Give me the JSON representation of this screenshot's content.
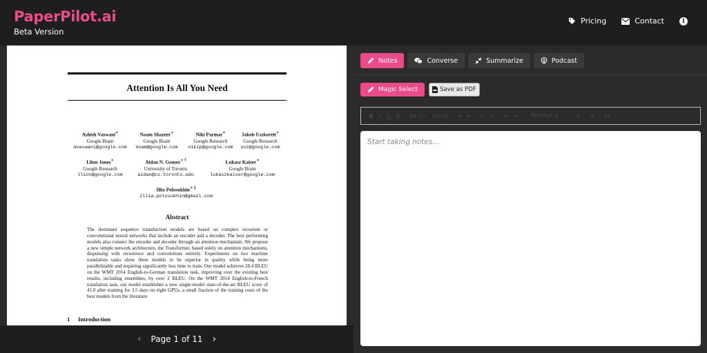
{
  "header": {
    "brand_title": "PaperPilot.ai",
    "brand_subtitle": "Beta Version",
    "nav": [
      {
        "label": "Pricing",
        "icon": "tag-icon"
      },
      {
        "label": "Contact",
        "icon": "envelope-icon"
      }
    ],
    "info_glyph": "i"
  },
  "paper": {
    "title": "Attention Is All You Need",
    "authors": [
      {
        "name": "Ashish Vaswani",
        "mark": "∗",
        "affil": "Google Brain",
        "email": "avaswani@google.com"
      },
      {
        "name": "Noam Shazeer",
        "mark": "∗",
        "affil": "Google Brain",
        "email": "noam@google.com"
      },
      {
        "name": "Niki Parmar",
        "mark": "∗",
        "affil": "Google Research",
        "email": "nikip@google.com"
      },
      {
        "name": "Jakob Uszkoreit",
        "mark": "∗",
        "affil": "Google Research",
        "email": "usz@google.com"
      },
      {
        "name": "Llion Jones",
        "mark": "∗",
        "affil": "Google Research",
        "email": "llion@google.com"
      },
      {
        "name": "Aidan N. Gomez",
        "mark": "∗ †",
        "affil": "University of Toronto",
        "email": "aidan@cs.toronto.edu"
      },
      {
        "name": "Łukasz Kaiser",
        "mark": "∗",
        "affil": "Google Brain",
        "email": "lukaszkaiser@google.com"
      },
      {
        "name": "Illia Polosukhin",
        "mark": "∗ ‡",
        "affil": "",
        "email": "illia.polosukhin@gmail.com"
      }
    ],
    "abstract_heading": "Abstract",
    "abstract": "The dominant sequence transduction models are based on complex recurrent or convolutional neural networks that include an encoder and a decoder. The best performing models also connect the encoder and decoder through an attention mechanism. We propose a new simple network architecture, the Transformer, based solely on attention mechanisms, dispensing with recurrence and convolutions entirely. Experiments on two machine translation tasks show these models to be superior in quality while being more parallelizable and requiring significantly less time to train. Our model achieves 28.4 BLEU on the WMT 2014 English-to-German translation task, improving over the existing best results, including ensembles, by over 2 BLEU. On the WMT 2014 English-to-French translation task, our model establishes a new single-model state-of-the-art BLEU score of 41.0 after training for 3.5 days on eight GPUs, a small fraction of the training costs of the best models from the literature.",
    "section_number": "1",
    "section_title": "Introduction"
  },
  "pager": {
    "prev": "‹",
    "text": "Page 1 of 11",
    "next": "›"
  },
  "tabs": [
    {
      "label": "Notes",
      "icon": "pencil-icon",
      "active": true
    },
    {
      "label": "Converse",
      "icon": "chat-bubbles-icon",
      "active": false
    },
    {
      "label": "Summarize",
      "icon": "compress-arrows-icon",
      "active": false
    },
    {
      "label": "Podcast",
      "icon": "podcast-icon",
      "active": false
    }
  ],
  "tools": {
    "magic_select": "Magic Select",
    "save_pdf": "Save as PDF"
  },
  "editor_toolbar": {
    "bold": "B",
    "italic": "I",
    "underline": "U",
    "strike": "S",
    "quote": "99",
    "code": "<>",
    "h1": "H1",
    "h2": "H2",
    "ol": "≡",
    "ul": "≡",
    "sub": "x₂",
    "sup": "x²",
    "outdent": "⇤",
    "indent": "⇥",
    "heading_select": "Normal",
    "color": "A",
    "align": "≡",
    "clear": "Tx"
  },
  "notes": {
    "placeholder": "Start taking notes..."
  },
  "colors": {
    "accent": "#ea4c89",
    "background": "#1e1e1e",
    "panel": "#2b2b2b"
  }
}
